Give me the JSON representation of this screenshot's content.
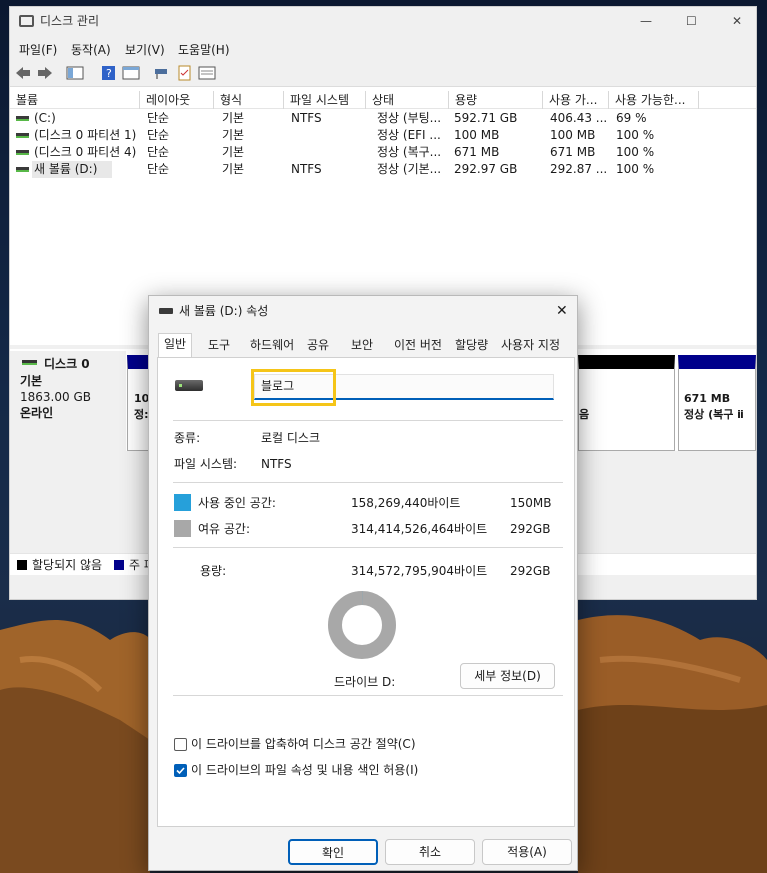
{
  "window": {
    "title": "디스크 관리",
    "min": "—",
    "max": "☐",
    "close": "✕"
  },
  "menu": [
    "파일(F)",
    "동작(A)",
    "보기(V)",
    "도움말(H)"
  ],
  "columns": [
    "볼륨",
    "레이아웃",
    "형식",
    "파일 시스템",
    "상태",
    "용량",
    "사용 가...",
    "사용 가능한..."
  ],
  "volumes": [
    [
      "(C:)",
      "단순",
      "기본",
      "NTFS",
      "정상 (부팅...",
      "592.71 GB",
      "406.43 ...",
      "69 %"
    ],
    [
      "(디스크 0 파티션 1)",
      "단순",
      "기본",
      "",
      "정상 (EFI ...",
      "100 MB",
      "100 MB",
      "100 %"
    ],
    [
      "(디스크 0 파티션 4)",
      "단순",
      "기본",
      "",
      "정상 (복구...",
      "671 MB",
      "671 MB",
      "100 %"
    ],
    [
      "새 볼륨 (D:)",
      "단순",
      "기본",
      "NTFS",
      "정상 (기본...",
      "292.97 GB",
      "292.87 ...",
      "100 %"
    ]
  ],
  "disk": {
    "name": "디스크 0",
    "type": "기본",
    "size": "1863.00 GB",
    "status": "온라인"
  },
  "partitions_partial": {
    "left_size": "10(",
    "left_status": "정:",
    "mid_status": "음",
    "right_size": "671 MB",
    "right_status": "정상 (복구 ⅱ"
  },
  "legend": {
    "unallocated": "할당되지 않음",
    "primary": "주 파"
  },
  "dialog": {
    "title": "새 볼륨 (D:) 속성",
    "close": "✕",
    "tabs": [
      "일반",
      "도구",
      "하드웨어",
      "공유",
      "보안",
      "이전 버전",
      "할당량",
      "사용자 지정"
    ],
    "volume_name": "블로그",
    "type_label": "종류:",
    "type_value": "로컬 디스크",
    "fs_label": "파일 시스템:",
    "fs_value": "NTFS",
    "used_label": "사용 중인 공간:",
    "used_bytes": "158,269,440바이트",
    "used_size": "150MB",
    "free_label": "여유 공간:",
    "free_bytes": "314,414,526,464바이트",
    "free_size": "292GB",
    "cap_label": "용량:",
    "cap_bytes": "314,572,795,904바이트",
    "cap_size": "292GB",
    "drive_label": "드라이브 D:",
    "details_button": "세부 정보(D)",
    "compress_label": "이 드라이브를 압축하여 디스크 공간 절약(C)",
    "index_label": "이 드라이브의 파일 속성 및 내용 색인 허용(I)",
    "ok": "확인",
    "cancel": "취소",
    "apply": "적용(A)"
  },
  "colors": {
    "used": "#26a0da",
    "free": "#a8a8a8",
    "accent": "#005fb8",
    "highlight": "#f5c518",
    "primary_bar": "#00008b",
    "unallocated": "#000000"
  }
}
